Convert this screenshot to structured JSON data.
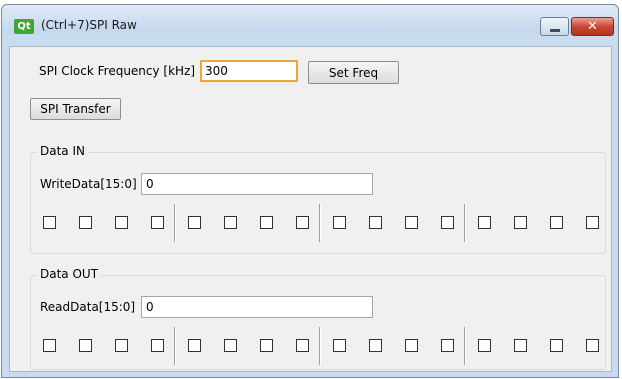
{
  "window": {
    "icon_text": "Qt",
    "title": "(Ctrl+7)SPI Raw",
    "close_glyph": "✕"
  },
  "clock": {
    "label": "SPI Clock Frequency [kHz]",
    "value": "300",
    "set_button": "Set Freq"
  },
  "transfer_button": "SPI Transfer",
  "data_in": {
    "title": "Data IN",
    "field_label": "WriteData[15:0]",
    "value": "0",
    "bits": 16
  },
  "data_out": {
    "title": "Data OUT",
    "field_label": "ReadData[15:0]",
    "value": "0",
    "bits": 16
  }
}
